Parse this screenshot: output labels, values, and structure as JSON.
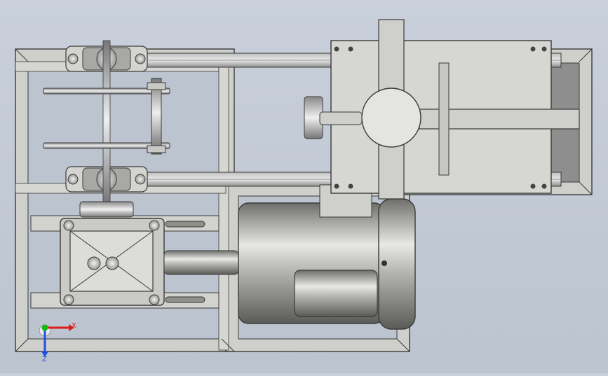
{
  "view": {
    "type": "CAD assembly top view",
    "colors": {
      "background": "#c4cbd6",
      "frame": "#c8c8c4",
      "frame_edge": "#3a3a3a",
      "plate": "#d4d4d2",
      "motor_body": "#9c9c98",
      "motor_highlight": "#eeeeea",
      "rail": "#9a9a9a",
      "axis_x": "#e11b1b",
      "axis_y": "#16b816",
      "axis_z": "#2050e0"
    }
  },
  "axis_triad": {
    "x_label": "X",
    "z_label": "Z"
  }
}
